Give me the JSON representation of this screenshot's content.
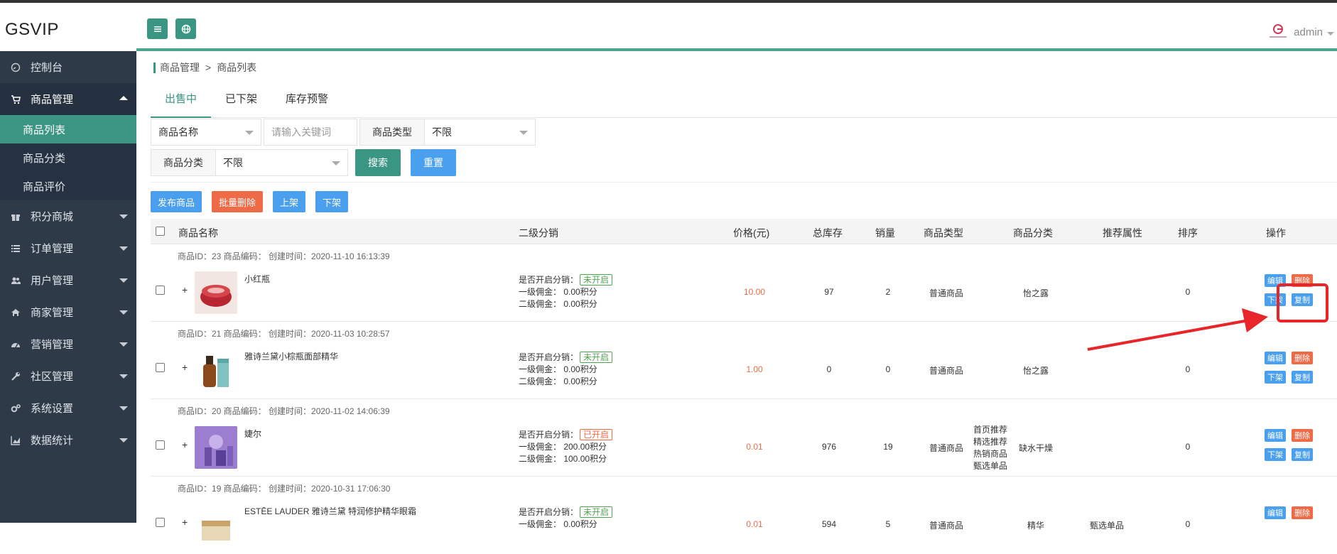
{
  "app": {
    "title": "GSVIP"
  },
  "header": {
    "user": "admin"
  },
  "sidebar": {
    "items": [
      {
        "label": "控制台",
        "icon": "dashboard-icon"
      },
      {
        "label": "商品管理",
        "icon": "cart-icon",
        "open": true
      },
      {
        "label": "积分商城",
        "icon": "gift-icon"
      },
      {
        "label": "订单管理",
        "icon": "list-icon"
      },
      {
        "label": "用户管理",
        "icon": "users-icon"
      },
      {
        "label": "商家管理",
        "icon": "home-icon"
      },
      {
        "label": "营销管理",
        "icon": "gauge-icon"
      },
      {
        "label": "社区管理",
        "icon": "wrench-icon"
      },
      {
        "label": "系统设置",
        "icon": "gears-icon"
      },
      {
        "label": "数据统计",
        "icon": "chart-icon"
      }
    ],
    "sub_items": [
      {
        "label": "商品列表",
        "active": true
      },
      {
        "label": "商品分类"
      },
      {
        "label": "商品评价"
      }
    ]
  },
  "breadcrumb": {
    "parent": "商品管理",
    "sep": ">",
    "current": "商品列表"
  },
  "tabs": [
    {
      "label": "出售中"
    },
    {
      "label": "已下架"
    },
    {
      "label": "库存预警"
    }
  ],
  "filters": {
    "name_select": "商品名称",
    "keyword_placeholder": "请输入关键词",
    "type_label": "商品类型",
    "type_value": "不限",
    "category_label": "商品分类",
    "category_value": "不限",
    "search": "搜索",
    "reset": "重置"
  },
  "actions": {
    "publish": "发布商品",
    "batch_delete": "批量删除",
    "on_shelf": "上架",
    "off_shelf": "下架"
  },
  "columns": {
    "name": "商品名称",
    "distribution": "二级分销",
    "price": "价格(元)",
    "stock": "总库存",
    "sales": "销量",
    "type": "商品类型",
    "category": "商品分类",
    "recommend": "推荐属性",
    "sort": "排序",
    "ops": "操作"
  },
  "rows": [
    {
      "meta": "商品ID：23 商品编码：    创建时间：2020-11-10 16:13:39",
      "name": "小红瓶",
      "dist_label": "是否开启分销：",
      "dist_status": "未开启",
      "level1": "一级佣金：    0.00积分",
      "level2": "二级佣金：    0.00积分",
      "price": "10.00",
      "stock": "97",
      "sales": "2",
      "type": "普通商品",
      "category": "怡之露",
      "recommend": [],
      "sort": "0",
      "ops": {
        "edit": "编辑",
        "delete": "删除",
        "off": "下架",
        "copy": "复制"
      }
    },
    {
      "meta": "商品ID：21 商品编码：    创建时间：2020-11-03 10:28:57",
      "name": "雅诗兰黛小棕瓶面部精华",
      "dist_label": "是否开启分销：",
      "dist_status": "未开启",
      "level1": "一级佣金：    0.00积分",
      "level2": "二级佣金：    0.00积分",
      "price": "1.00",
      "stock": "0",
      "sales": "0",
      "type": "普通商品",
      "category": "怡之露",
      "recommend": [],
      "sort": "0",
      "ops": {
        "edit": "编辑",
        "delete": "删除",
        "off": "下架",
        "copy": "复制"
      }
    },
    {
      "meta": "商品ID：20 商品编码：    创建时间：2020-11-02 14:06:39",
      "name": "婕尔",
      "dist_label": "是否开启分销：",
      "dist_status": "已开启",
      "level1": "一级佣金：    200.00积分",
      "level2": "二级佣金：    100.00积分",
      "price": "0.01",
      "stock": "976",
      "sales": "19",
      "type": "普通商品",
      "category": "缺水干燥",
      "recommend": [
        "首页推荐",
        "精选推荐",
        "热销商品",
        "甄选单品"
      ],
      "sort": "0",
      "ops": {
        "edit": "编辑",
        "delete": "删除",
        "off": "下架",
        "copy": "复制"
      }
    },
    {
      "meta": "商品ID：19 商品编码：    创建时间：2020-10-31 17:06:30",
      "name": "ESTĒE LAUDER 雅诗兰黛 特润修护精华眼霜",
      "dist_label": "是否开启分销：",
      "dist_status": "未开启",
      "level1": "一级佣金：    0.00积分",
      "level2": "",
      "price": "0.01",
      "stock": "594",
      "sales": "5",
      "type": "普通商品",
      "category": "精华",
      "recommend": [
        "甄选单品"
      ],
      "sort": "0",
      "ops": {
        "edit": "编辑",
        "delete": "删除",
        "off": "",
        "copy": ""
      }
    }
  ],
  "colors": {
    "accent": "#3a9683",
    "blue": "#4aa0ef",
    "red": "#ef6b48",
    "sidebar": "#2f3a48"
  }
}
